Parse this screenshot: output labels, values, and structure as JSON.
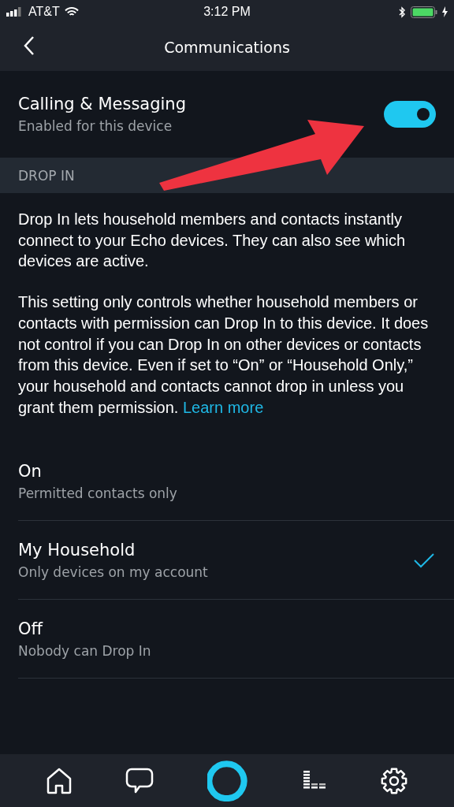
{
  "status_bar": {
    "carrier": "AT&T",
    "time": "3:12 PM"
  },
  "nav": {
    "title": "Communications"
  },
  "calling": {
    "title": "Calling & Messaging",
    "subtitle": "Enabled for this device",
    "on": true
  },
  "section": {
    "header": "DROP IN"
  },
  "description": "Drop In lets household members and contacts instantly connect to your Echo devices. They can also see which devices are active.",
  "details": {
    "text": "This setting only controls whether household members or contacts with permission can Drop In to this device. It does not control if you can Drop In on other devices or contacts from this device. Even if set to “On” or “Household Only,” your household and contacts cannot drop in unless you grant them permission.",
    "link": "Learn more"
  },
  "options": [
    {
      "title": "On",
      "subtitle": "Permitted contacts only",
      "selected": false
    },
    {
      "title": "My Household",
      "subtitle": "Only devices on my account",
      "selected": true
    },
    {
      "title": "Off",
      "subtitle": "Nobody can Drop In",
      "selected": false
    }
  ],
  "tab_bar": [
    {
      "kind": "home"
    },
    {
      "kind": "chat"
    },
    {
      "kind": "alexa"
    },
    {
      "kind": "play"
    },
    {
      "kind": "settings"
    }
  ]
}
